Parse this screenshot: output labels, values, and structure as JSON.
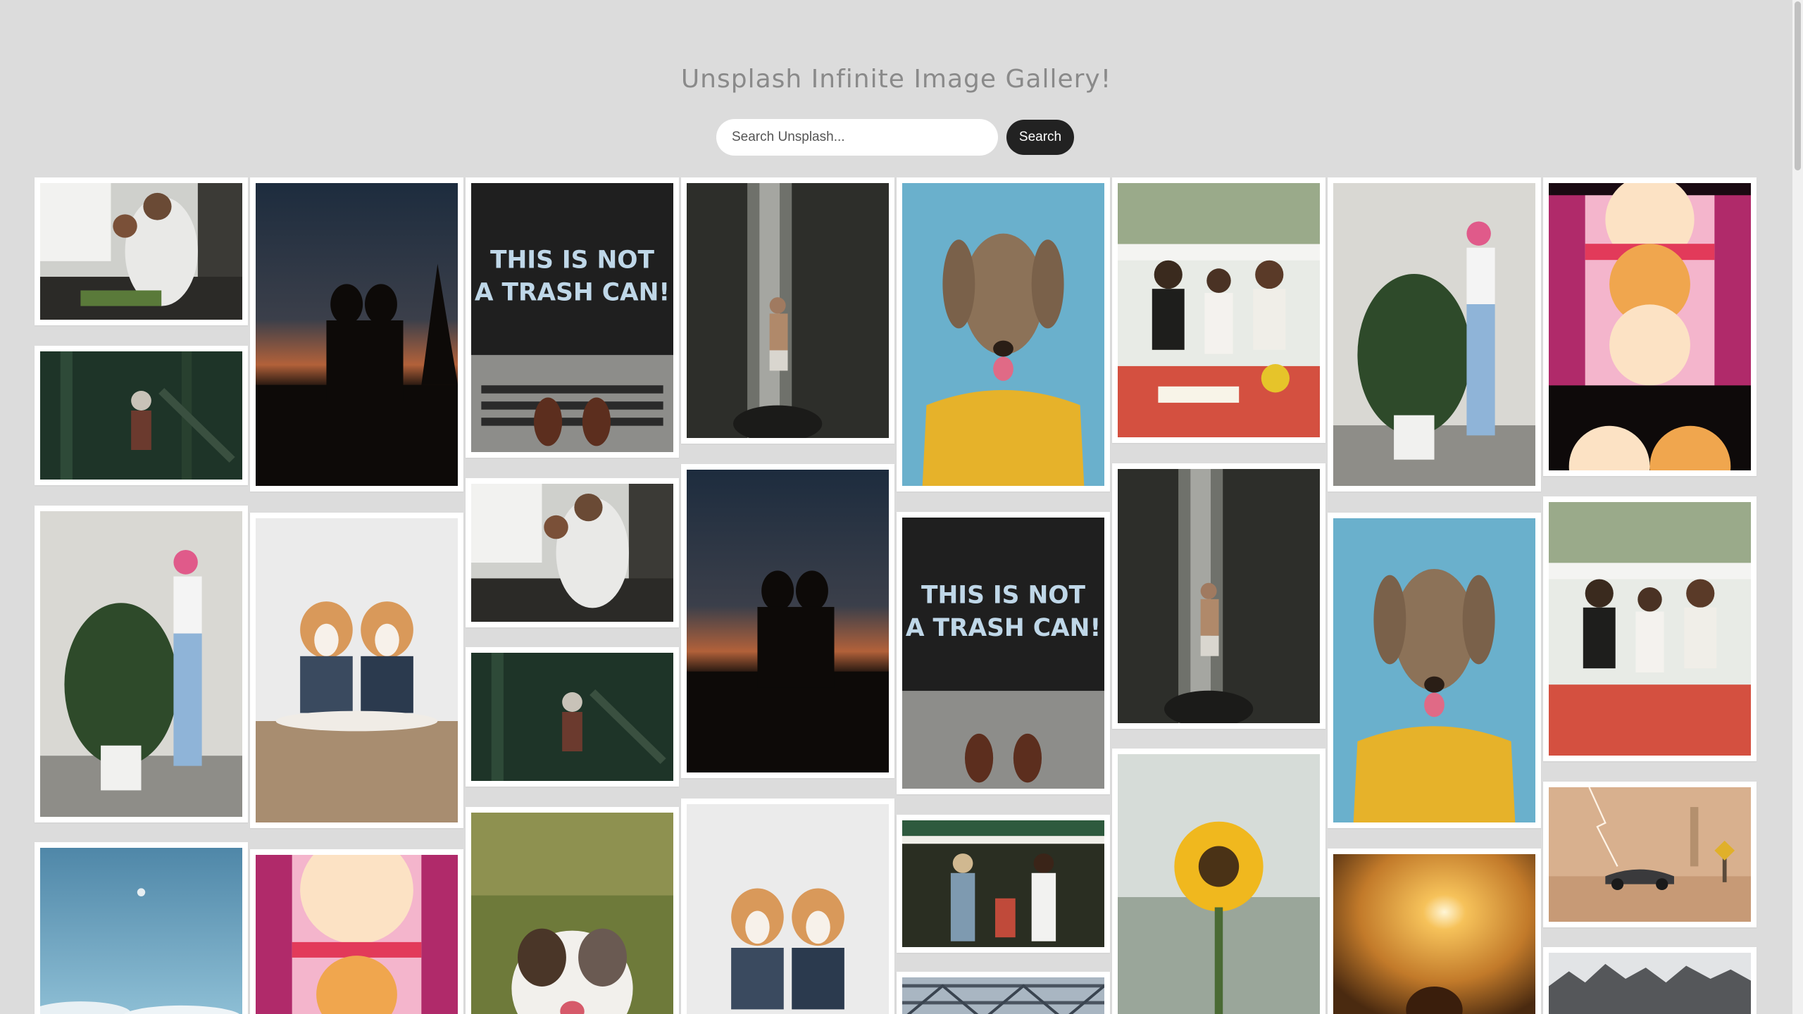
{
  "header": {
    "title": "Unsplash Infinite Image Gallery!"
  },
  "search": {
    "placeholder": "Search Unsplash...",
    "button_label": "Search"
  },
  "gallery": {
    "images": [
      {
        "subject": "cooking-family"
      },
      {
        "subject": "couple-silhouette-sunset"
      },
      {
        "subject": "not-a-trash-can-street"
      },
      {
        "subject": "waterfall-man"
      },
      {
        "subject": "dog-yellow-sweater"
      },
      {
        "subject": "family-dining-terrace"
      },
      {
        "subject": "woman-monstera-plant"
      },
      {
        "subject": "geometric-pattern"
      },
      {
        "subject": "jungle-astronaut"
      },
      {
        "subject": "corgis"
      },
      {
        "subject": "sunflower"
      },
      {
        "subject": "women-laughing-market"
      },
      {
        "subject": "australian-shepherd"
      },
      {
        "subject": "sunset-dog"
      },
      {
        "subject": "car-desert-lightning"
      },
      {
        "subject": "sky-moon"
      },
      {
        "subject": "rocky-mountains"
      },
      {
        "subject": "bridge-structure"
      }
    ]
  },
  "colors": {
    "background": "#dcdcdc",
    "button": "#222222",
    "title": "#8a8a8a"
  }
}
